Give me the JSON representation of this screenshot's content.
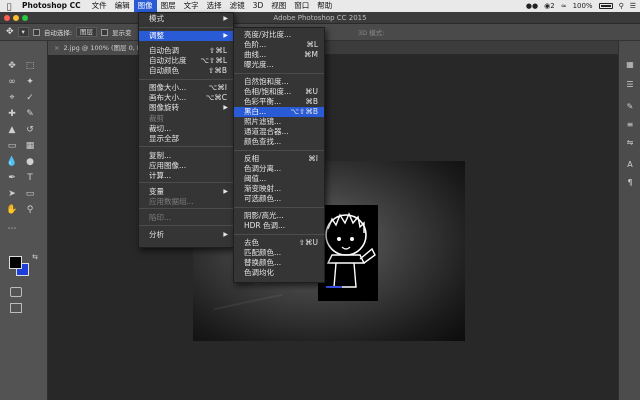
{
  "menubar": {
    "app": "Photoshop CC",
    "items": [
      "文件",
      "编辑",
      "图像",
      "图层",
      "文字",
      "选择",
      "滤镜",
      "3D",
      "视图",
      "窗口",
      "帮助"
    ],
    "active_index": 2,
    "status": {
      "notify_count": "2",
      "battery": "100%"
    }
  },
  "window": {
    "title": "Adobe Photoshop CC 2015"
  },
  "options": {
    "auto_select": "自动选择:",
    "layer_dd": "图层",
    "show_transform": "显示变",
    "mode_3d": "3D 模式:"
  },
  "document": {
    "tab": "2.jpg @ 100% (图层 0, RGB/"
  },
  "image_menu": {
    "items": [
      {
        "label": "模式",
        "shortcut": "",
        "submenu": true
      },
      {
        "label": "调整",
        "shortcut": "",
        "submenu": true,
        "highlighted": true
      },
      {
        "label": "自动色调",
        "shortcut": "⇧⌘L"
      },
      {
        "label": "自动对比度",
        "shortcut": "⌥⇧⌘L"
      },
      {
        "label": "自动颜色",
        "shortcut": "⇧⌘B"
      },
      {
        "label": "图像大小...",
        "shortcut": "⌥⌘I"
      },
      {
        "label": "画布大小...",
        "shortcut": "⌥⌘C"
      },
      {
        "label": "图像旋转",
        "shortcut": "",
        "submenu": true
      },
      {
        "label": "裁剪",
        "shortcut": "",
        "disabled": true
      },
      {
        "label": "裁切...",
        "shortcut": ""
      },
      {
        "label": "显示全部",
        "shortcut": ""
      },
      {
        "label": "复制...",
        "shortcut": ""
      },
      {
        "label": "应用图像...",
        "shortcut": ""
      },
      {
        "label": "计算...",
        "shortcut": ""
      },
      {
        "label": "变量",
        "shortcut": "",
        "submenu": true
      },
      {
        "label": "应用数据组...",
        "shortcut": "",
        "disabled": true
      },
      {
        "label": "陷印...",
        "shortcut": "",
        "disabled": true
      },
      {
        "label": "分析",
        "shortcut": "",
        "submenu": true
      }
    ]
  },
  "adjust_menu": {
    "items": [
      {
        "label": "亮度/对比度...",
        "shortcut": ""
      },
      {
        "label": "色阶...",
        "shortcut": "⌘L"
      },
      {
        "label": "曲线...",
        "shortcut": "⌘M"
      },
      {
        "label": "曝光度...",
        "shortcut": ""
      },
      {
        "label": "自然饱和度...",
        "shortcut": ""
      },
      {
        "label": "色相/饱和度...",
        "shortcut": "⌘U"
      },
      {
        "label": "色彩平衡...",
        "shortcut": "⌘B"
      },
      {
        "label": "黑白...",
        "shortcut": "⌥⇧⌘B",
        "highlighted": true
      },
      {
        "label": "照片滤镜...",
        "shortcut": ""
      },
      {
        "label": "通道混合器...",
        "shortcut": ""
      },
      {
        "label": "颜色查找...",
        "shortcut": ""
      },
      {
        "label": "反相",
        "shortcut": "⌘I"
      },
      {
        "label": "色调分离...",
        "shortcut": ""
      },
      {
        "label": "阈值...",
        "shortcut": ""
      },
      {
        "label": "渐变映射...",
        "shortcut": ""
      },
      {
        "label": "可选颜色...",
        "shortcut": ""
      },
      {
        "label": "阴影/高光...",
        "shortcut": ""
      },
      {
        "label": "HDR 色调...",
        "shortcut": ""
      },
      {
        "label": "去色",
        "shortcut": "⇧⌘U"
      },
      {
        "label": "匹配颜色...",
        "shortcut": ""
      },
      {
        "label": "替换颜色...",
        "shortcut": ""
      },
      {
        "label": "色调均化",
        "shortcut": ""
      }
    ]
  },
  "colors": {
    "accent": "#2a5bd7",
    "foreground": "#000000",
    "background": "#1f3fd9"
  }
}
